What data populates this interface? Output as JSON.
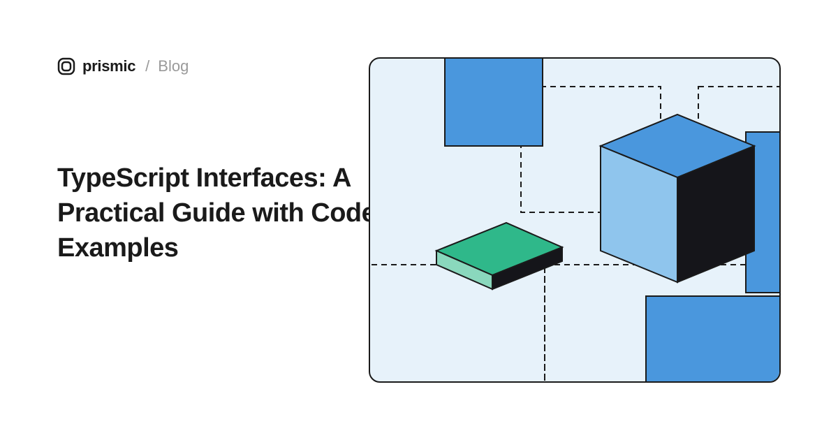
{
  "breadcrumb": {
    "brand": "prismic",
    "separator": "/",
    "section": "Blog"
  },
  "headline": "TypeScript Interfaces: A Practical Guide with Code Examples",
  "colors": {
    "background": "#ffffff",
    "text_primary": "#1a1a1a",
    "text_muted": "#9a9a9a",
    "panel_bg": "#e7f2fa",
    "blue_mid": "#4a97dd",
    "blue_light": "#8fc5ed",
    "green_top": "#2fb88a",
    "green_side": "#8ad8bd",
    "dark": "#15151a"
  }
}
